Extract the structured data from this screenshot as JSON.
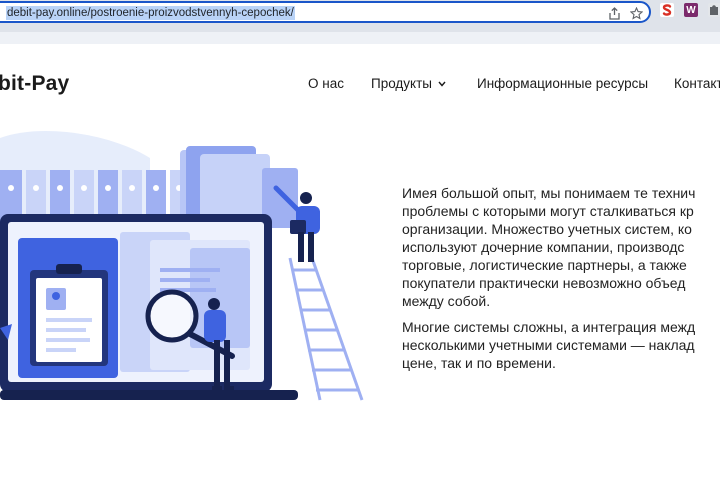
{
  "browser": {
    "url": "debit-pay.online/postroenie-proizvodstvennyh-cepochek/",
    "extension_s_color": "#d93025",
    "extension_w_color": "#7b2a6b",
    "extension_w_letter": "W"
  },
  "header": {
    "logo": "bit-Pay",
    "nav": [
      {
        "label": "О нас"
      },
      {
        "label": "Продукты"
      },
      {
        "label": "Информационные ресурсы"
      },
      {
        "label": "Контакт"
      }
    ]
  },
  "content": {
    "paragraph1": [
      "Имея большой опыт, мы понимаем те технич",
      "проблемы с которыми могут сталкиваться кр",
      "организации. Множество учетных систем, ко",
      "используют дочерние компании, производс",
      "торговые, логистические партнеры, а также",
      "покупатели практически невозможно объед",
      "между собой."
    ],
    "paragraph2": [
      "Многие системы сложны, а интеграция межд",
      "несколькими учетными системами — наклад",
      "цене, так и по времени."
    ]
  },
  "colors": {
    "accent": "#1a56c9",
    "illustration_blue": "#3f63e0",
    "illustration_light": "#dbe3fb",
    "text": "#1b1b1b"
  }
}
